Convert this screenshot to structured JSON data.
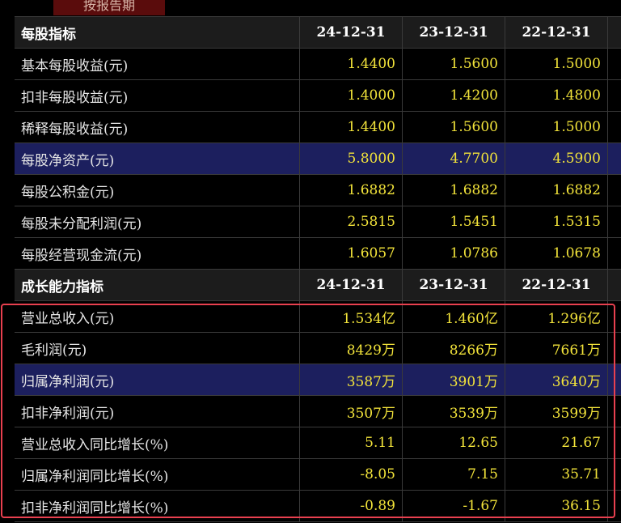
{
  "top_tab": {
    "label": "按报告期"
  },
  "section1": {
    "title": "每股指标",
    "columns": [
      "24-12-31",
      "23-12-31",
      "22-12-31"
    ],
    "rows": [
      {
        "label": "基本每股收益(元)",
        "values": [
          "1.4400",
          "1.5600",
          "1.5000"
        ]
      },
      {
        "label": "扣非每股收益(元)",
        "values": [
          "1.4000",
          "1.4200",
          "1.4800"
        ]
      },
      {
        "label": "稀释每股收益(元)",
        "values": [
          "1.4400",
          "1.5600",
          "1.5000"
        ]
      },
      {
        "label": "每股净资产(元)",
        "values": [
          "5.8000",
          "4.7700",
          "4.5900"
        ]
      },
      {
        "label": "每股公积金(元)",
        "values": [
          "1.6882",
          "1.6882",
          "1.6882"
        ]
      },
      {
        "label": "每股未分配利润(元)",
        "values": [
          "2.5815",
          "1.5451",
          "1.5315"
        ]
      },
      {
        "label": "每股经营现金流(元)",
        "values": [
          "1.6057",
          "1.0786",
          "1.0678"
        ]
      }
    ]
  },
  "section2": {
    "title": "成长能力指标",
    "columns": [
      "24-12-31",
      "23-12-31",
      "22-12-31"
    ],
    "rows": [
      {
        "label": "营业总收入(元)",
        "values": [
          "1.534亿",
          "1.460亿",
          "1.296亿"
        ]
      },
      {
        "label": "毛利润(元)",
        "values": [
          "8429万",
          "8266万",
          "7661万"
        ]
      },
      {
        "label": "归属净利润(元)",
        "values": [
          "3587万",
          "3901万",
          "3640万"
        ]
      },
      {
        "label": "扣非净利润(元)",
        "values": [
          "3507万",
          "3539万",
          "3599万"
        ]
      },
      {
        "label": "营业总收入同比增长(%)",
        "values": [
          "5.11",
          "12.65",
          "21.67"
        ]
      },
      {
        "label": "归属净利润同比增长(%)",
        "values": [
          "-8.05",
          "7.15",
          "35.71"
        ]
      },
      {
        "label": "扣非净利润同比增长(%)",
        "values": [
          "-0.89",
          "-1.67",
          "36.15"
        ]
      }
    ]
  },
  "colors": {
    "background": "#000000",
    "header_bg": "#1c1c1c",
    "highlight_row": "#1c1f5e",
    "value_text": "#f2e33a",
    "label_text": "#e6e6e6",
    "frame": "#e8404f",
    "tab_bg": "#5a0c0c"
  }
}
